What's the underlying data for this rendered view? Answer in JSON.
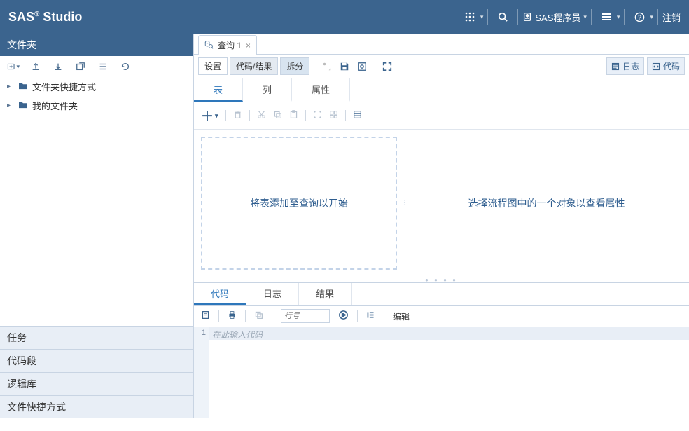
{
  "brand": {
    "name": "SAS",
    "suffix": "Studio"
  },
  "topbar": {
    "user_label": "SAS程序员",
    "signout": "注销"
  },
  "leftpanel": {
    "header": "文件夹",
    "tree": {
      "folder_shortcuts": "文件夹快捷方式",
      "my_folders": "我的文件夹"
    },
    "accordion": {
      "tasks": "任务",
      "snippets": "代码段",
      "libraries": "逻辑库",
      "file_shortcuts": "文件快捷方式"
    }
  },
  "tab": {
    "label": "查询 1"
  },
  "maintoolbar": {
    "settings": "设置",
    "code_results": "代码/结果",
    "split": "拆分",
    "log_btn": "日志",
    "code_btn": "代码"
  },
  "subtabs": {
    "table": "表",
    "column": "列",
    "attr": "属性"
  },
  "dropzone_text": "将表添加至查询以开始",
  "propzone_text": "选择流程图中的一个对象以查看属性",
  "bottom": {
    "tabs": {
      "code": "代码",
      "log": "日志",
      "results": "结果"
    },
    "line_placeholder": "行号",
    "edit_label": "编辑",
    "line_no": "1",
    "code_placeholder": "在此输入代码"
  }
}
